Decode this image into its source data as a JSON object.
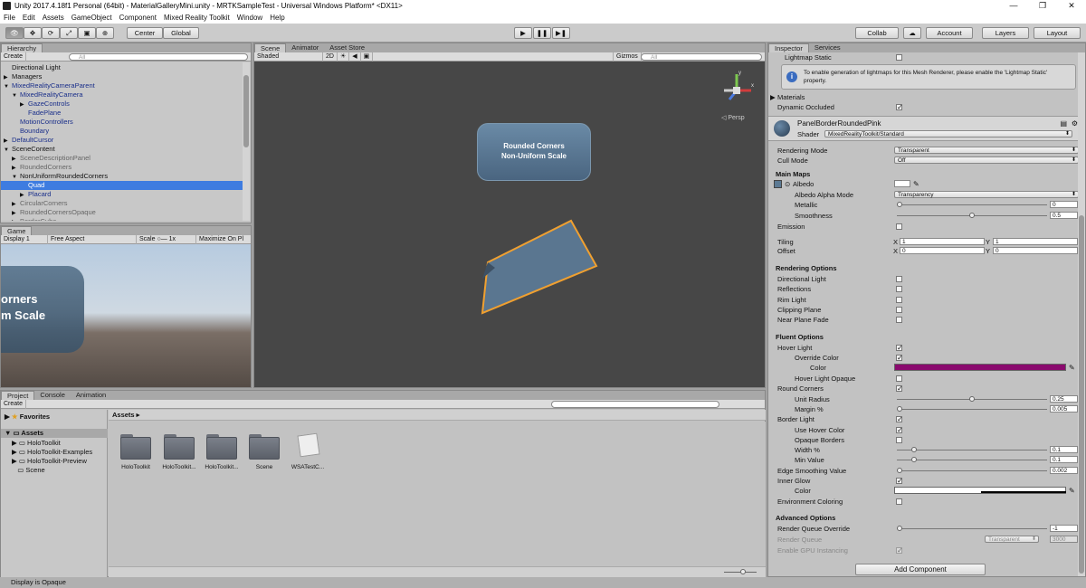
{
  "window": {
    "title": "Unity 2017.4.18f1 Personal (64bit) - MaterialGalleryMini.unity - MRTKSampleTest - Universal Windows Platform* <DX11>",
    "minimize": "—",
    "maximize": "❐",
    "close": "✕"
  },
  "menu": [
    "File",
    "Edit",
    "Assets",
    "GameObject",
    "Component",
    "Mixed Reality Toolkit",
    "Window",
    "Help"
  ],
  "toolbar": {
    "tools": [
      "hand-icon",
      "move-icon",
      "rotate-icon",
      "scale-icon",
      "rect-icon",
      "transform-icon"
    ],
    "center": "Center",
    "global": "Global",
    "play": "▶",
    "pause": "❚❚",
    "step": "▶❚",
    "collab": "Collab",
    "cloud": "☁",
    "account": "Account",
    "layers": "Layers",
    "layout": "Layout"
  },
  "hierarchy": {
    "tab": "Hierarchy",
    "create": "Create",
    "search": "All",
    "items": [
      {
        "label": "Directional Light",
        "indent": 1,
        "arrow": "",
        "style": ""
      },
      {
        "label": "Managers",
        "indent": 1,
        "arrow": "▶",
        "style": ""
      },
      {
        "label": "MixedRealityCameraParent",
        "indent": 1,
        "arrow": "▼",
        "style": "blue"
      },
      {
        "label": "MixedRealityCamera",
        "indent": 2,
        "arrow": "▼",
        "style": "blue"
      },
      {
        "label": "GazeControls",
        "indent": 3,
        "arrow": "▶",
        "style": "blue"
      },
      {
        "label": "FadePlane",
        "indent": 3,
        "arrow": "",
        "style": "blue"
      },
      {
        "label": "MotionControllers",
        "indent": 2,
        "arrow": "",
        "style": "blue"
      },
      {
        "label": "Boundary",
        "indent": 2,
        "arrow": "",
        "style": "blue"
      },
      {
        "label": "DefaultCursor",
        "indent": 1,
        "arrow": "▶",
        "style": "blue"
      },
      {
        "label": "SceneContent",
        "indent": 1,
        "arrow": "▼",
        "style": ""
      },
      {
        "label": "SceneDescriptionPanel",
        "indent": 2,
        "arrow": "▶",
        "style": "grey"
      },
      {
        "label": "RoundedCorners",
        "indent": 2,
        "arrow": "▶",
        "style": "grey"
      },
      {
        "label": "NonUniformRoundedCorners",
        "indent": 2,
        "arrow": "▼",
        "style": ""
      },
      {
        "label": "Quad",
        "indent": 3,
        "arrow": "",
        "style": "sel"
      },
      {
        "label": "Placard",
        "indent": 3,
        "arrow": "▶",
        "style": "blue"
      },
      {
        "label": "CircularCorners",
        "indent": 2,
        "arrow": "▶",
        "style": "grey"
      },
      {
        "label": "RoundedCornersOpaque",
        "indent": 2,
        "arrow": "▶",
        "style": "grey"
      },
      {
        "label": "BorderCube",
        "indent": 2,
        "arrow": "▶",
        "style": "grey"
      }
    ]
  },
  "game": {
    "tab": "Game",
    "display": "Display 1",
    "aspect": "Free Aspect",
    "scale_label": "Scale",
    "scale_value": "1x",
    "maximize": "Maximize On Pl",
    "text_line1": "orners",
    "text_line2": "m Scale"
  },
  "scene": {
    "tabs": [
      "Scene",
      "Animator",
      "Asset Store"
    ],
    "shading": "Shaded",
    "mode2d": "2D",
    "gizmos": "Gizmos",
    "search": "All",
    "panel_line1": "Rounded Corners",
    "panel_line2": "Non-Uniform Scale",
    "persp": "Persp",
    "axis_x": "x",
    "axis_y": "y"
  },
  "project": {
    "tabs": [
      "Project",
      "Console",
      "Animation"
    ],
    "create": "Create",
    "favorites": "Favorites",
    "assets_root": "Assets",
    "tree": [
      "HoloToolkit",
      "HoloToolkit-Examples",
      "HoloToolkit-Preview",
      "Scene"
    ],
    "breadcrumb": "Assets ▸",
    "items": [
      "HoloToolkit",
      "HoloToolkit...",
      "HoloToolkit...",
      "Scene",
      "WSATestC..."
    ],
    "status": "Display is Opaque"
  },
  "inspector": {
    "tabs": [
      "Inspector",
      "Services"
    ],
    "lightmap_static": "Lightmap Static",
    "info": "To enable generation of lightmaps for this Mesh Renderer, please enable the 'Lightmap Static' property.",
    "materials": "Materials",
    "dynamic_occluded": "Dynamic Occluded",
    "material_name": "PanelBorderRoundedPink",
    "shader_label": "Shader",
    "shader_value": "MixedRealityToolkit/Standard",
    "rendering_mode": {
      "label": "Rendering Mode",
      "value": "Transparent"
    },
    "cull_mode": {
      "label": "Cull Mode",
      "value": "Off"
    },
    "main_maps": "Main Maps",
    "albedo": "Albedo",
    "albedo_alpha_mode": {
      "label": "Albedo Alpha Mode",
      "value": "Transparency"
    },
    "metallic": {
      "label": "Metallic",
      "value": "0",
      "fraction": 0.0
    },
    "smoothness": {
      "label": "Smoothness",
      "value": "0.5",
      "fraction": 0.5
    },
    "emission": "Emission",
    "tiling": {
      "label": "Tiling",
      "x": "1",
      "y": "1"
    },
    "offset": {
      "label": "Offset",
      "x": "0",
      "y": "0"
    },
    "axis_x": "X",
    "axis_y": "Y",
    "rendering_options": "Rendering Options",
    "render_opts": [
      "Directional Light",
      "Reflections",
      "Rim Light",
      "Clipping Plane",
      "Near Plane Fade"
    ],
    "fluent_options": "Fluent Options",
    "hover_light": "Hover Light",
    "override_color": "Override Color",
    "color": "Color",
    "hover_color": "#8a0a6e",
    "hover_light_opaque": "Hover Light Opaque",
    "round_corners": "Round Corners",
    "unit_radius": {
      "label": "Unit Radius",
      "value": "0.25",
      "fraction": 0.5
    },
    "margin": {
      "label": "Margin %",
      "value": "0.005",
      "fraction": 0.0
    },
    "border_light": "Border Light",
    "use_hover_color": "Use Hover Color",
    "opaque_borders": "Opaque Borders",
    "width": {
      "label": "Width %",
      "value": "0.1",
      "fraction": 0.1
    },
    "min_value": {
      "label": "Min Value",
      "value": "0.1",
      "fraction": 0.1
    },
    "edge_smoothing": {
      "label": "Edge Smoothing Value",
      "value": "0.002",
      "fraction": 0.0
    },
    "inner_glow": "Inner Glow",
    "inner_glow_color": "Color",
    "env_coloring": "Environment Coloring",
    "advanced_options": "Advanced Options",
    "render_queue_override": {
      "label": "Render Queue Override",
      "value": "-1",
      "fraction": 0.0
    },
    "render_queue": {
      "label": "Render Queue",
      "dropdown": "Transparent",
      "value": "3000"
    },
    "gpu_instancing": "Enable GPU Instancing",
    "add_component": "Add Component"
  }
}
